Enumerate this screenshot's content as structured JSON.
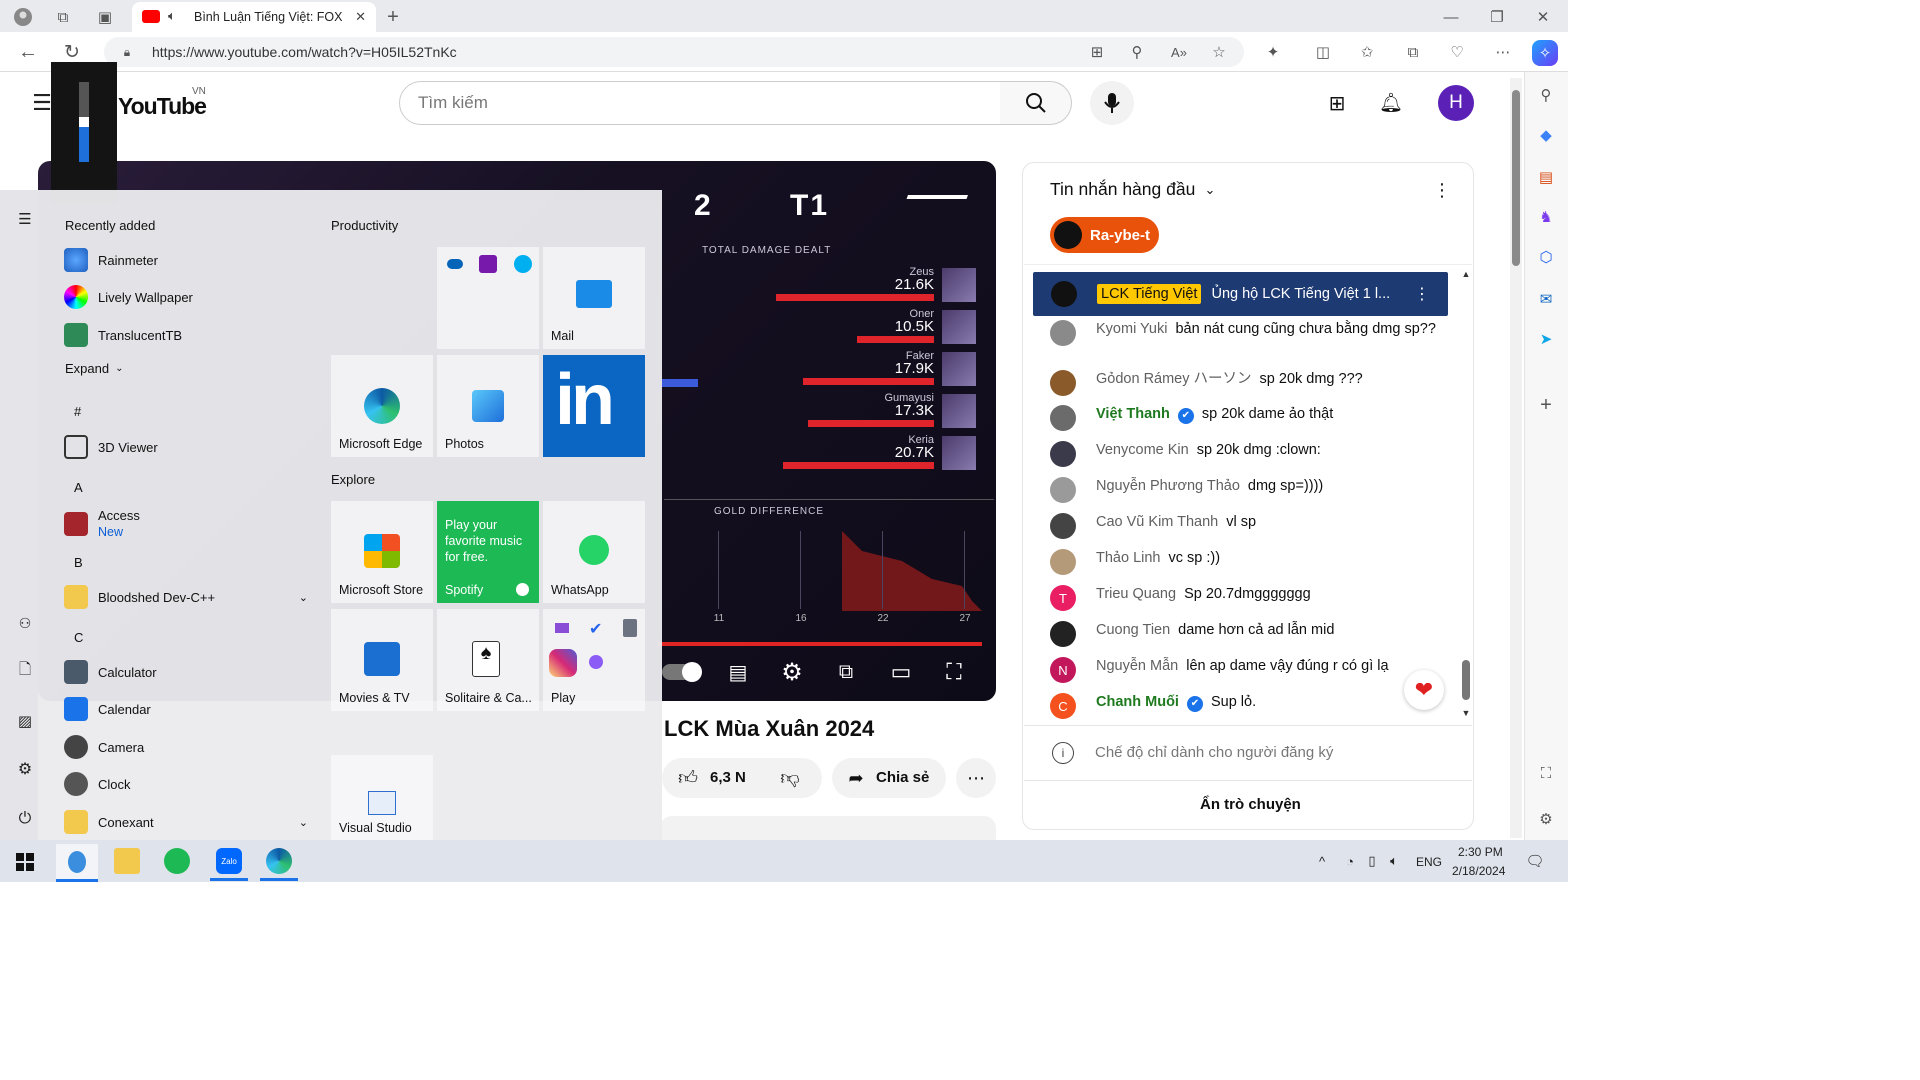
{
  "browser": {
    "tab_title": "Bình Luận Tiếng Việt: FOX vs",
    "url": "https://www.youtube.com/watch?v=H05IL52TnKc"
  },
  "youtube": {
    "logo_text": "YouTube",
    "region": "VN",
    "search_placeholder": "Tìm kiếm",
    "avatar_letter": "H",
    "video_title": "LCK Mùa Xuân 2024",
    "like_count": "6,3 N",
    "share_label": "Chia sẻ"
  },
  "overlay": {
    "team_score": "2",
    "team_name": "T1",
    "damage_title": "TOTAL DAMAGE DEALT",
    "gold_title": "GOLD DIFFERENCE",
    "gold_ticks": [
      "11",
      "16",
      "22",
      "27"
    ],
    "players": [
      {
        "name": "Zeus",
        "value": "21.6K",
        "fraction": 0.93
      },
      {
        "name": "Oner",
        "value": "10.5K",
        "fraction": 0.45
      },
      {
        "name": "Faker",
        "value": "17.9K",
        "fraction": 0.77
      },
      {
        "name": "Gumayusi",
        "value": "17.3K",
        "fraction": 0.74
      },
      {
        "name": "Keria",
        "value": "20.7K",
        "fraction": 0.89
      }
    ]
  },
  "chat": {
    "header": "Tin nhắn hàng đầu",
    "pinned_user": "Ra-ybe-t",
    "highlight_author": "LCK Tiếng Việt",
    "highlight_text": "Ủng hộ LCK Tiếng Việt 1 l...",
    "messages": [
      {
        "author": "Kyomi Yuki",
        "text": "bản nát cung cũng chưa bằng dmg sp??",
        "color": "#8a8a8a",
        "verified": false
      },
      {
        "author": "Gỏdon Rámey ハーソン",
        "text": "sp 20k dmg ???",
        "color": "#8b5a2b",
        "verified": false
      },
      {
        "author": "Việt Thanh",
        "text": "sp 20k dame ảo thật",
        "color": "#6b6b6b",
        "verified": true
      },
      {
        "author": "Venycome Kin",
        "text": "sp 20k dmg :clown:",
        "color": "#3a3a4a",
        "verified": false
      },
      {
        "author": "Nguyễn Phương Thảo",
        "text": "dmg sp=))))",
        "color": "#9a9a9a",
        "verified": false
      },
      {
        "author": "Cao Vũ Kim Thanh",
        "text": "vl sp",
        "color": "#444",
        "verified": false
      },
      {
        "author": "Thảo Linh",
        "text": "vc sp :))",
        "color": "#b59a7a",
        "verified": false
      },
      {
        "author": "Trieu Quang",
        "text": "Sp 20.7dmggggggg",
        "color": "#e91e63",
        "verified": false,
        "initial": "T"
      },
      {
        "author": "Cuong Tien",
        "text": "dame hơn cả ad lẫn mid",
        "color": "#222",
        "verified": false
      },
      {
        "author": "Nguyễn Mẫn",
        "text": "lên ap dame vậy đúng r có gì lạ",
        "color": "#c2185b",
        "verified": false,
        "initial": "N"
      },
      {
        "author": "Chanh Muối",
        "text": "Sup lỏ.",
        "color": "#f4511e",
        "verified": true,
        "initial": "C"
      }
    ],
    "subscriber_mode": "Chế độ chỉ dành cho người đăng ký",
    "hide_chat": "Ẩn trò chuyện"
  },
  "startmenu": {
    "recently_added": "Recently added",
    "recent": [
      "Rainmeter",
      "Lively Wallpaper",
      "TranslucentTB"
    ],
    "expand": "Expand",
    "letters": [
      "#",
      "A",
      "B",
      "C"
    ],
    "apps": [
      {
        "name": "3D Viewer"
      },
      {
        "name": "Access",
        "sub": "New"
      },
      {
        "name": "Bloodshed Dev-C++"
      },
      {
        "name": "Calculator"
      },
      {
        "name": "Calendar"
      },
      {
        "name": "Camera"
      },
      {
        "name": "Clock"
      },
      {
        "name": "Conexant"
      }
    ],
    "productivity": "Productivity",
    "explore": "Explore",
    "tiles": {
      "mail": "Mail",
      "edge": "Microsoft Edge",
      "photos": "Photos",
      "store": "Microsoft Store",
      "spotify_promo": "Play your favorite music for free.",
      "spotify": "Spotify",
      "whatsapp": "WhatsApp",
      "movies": "Movies & TV",
      "solitaire": "Solitaire & Ca...",
      "play": "Play",
      "vs": "Visual Studio"
    }
  },
  "taskbar": {
    "lang": "ENG",
    "time": "2:30 PM",
    "date": "2/18/2024"
  },
  "colors": {
    "accent": "#1a4ea5",
    "youtube_red": "#ff0000",
    "spotify": "#1db954"
  }
}
